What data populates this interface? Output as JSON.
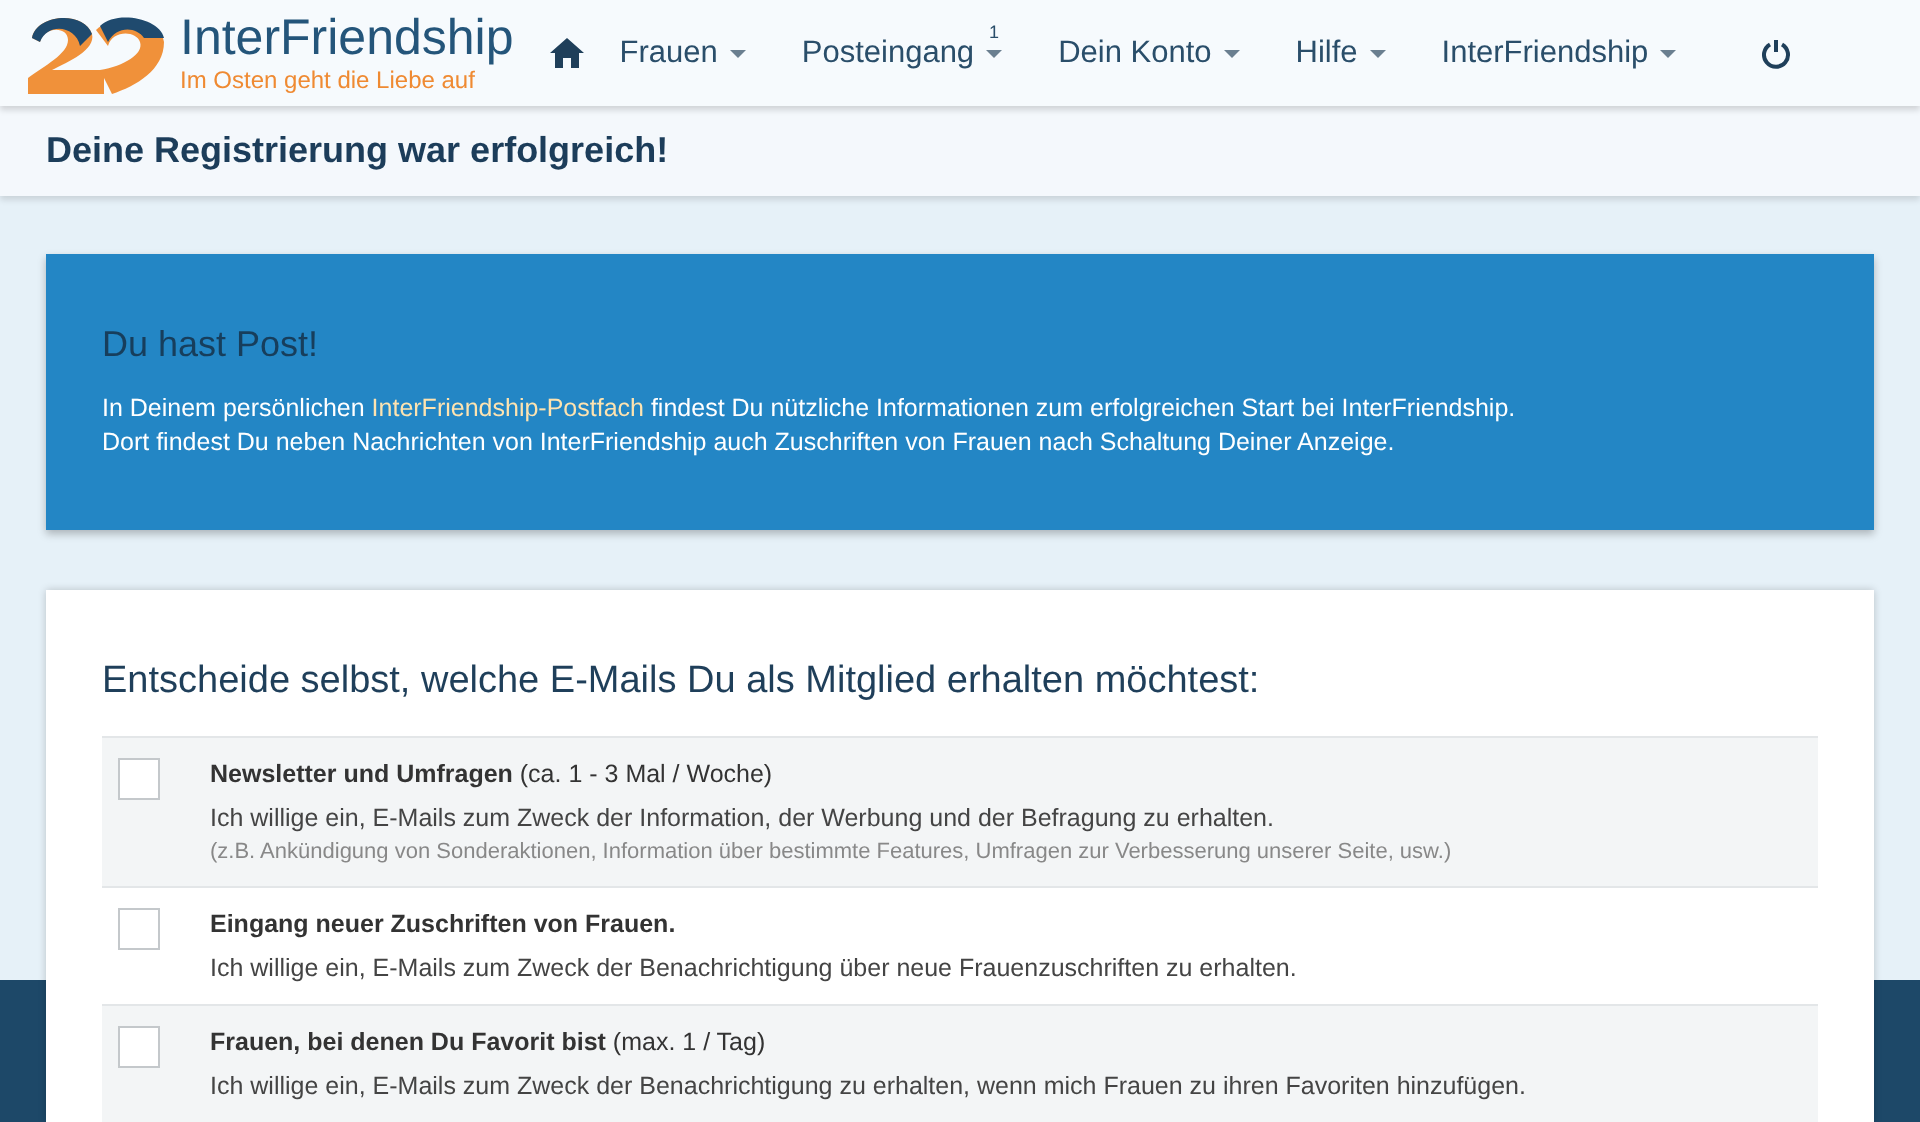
{
  "brand": {
    "name": "InterFriendship",
    "tagline": "Im Osten geht die Liebe auf"
  },
  "nav": [
    {
      "label": "Frauen"
    },
    {
      "label": "Posteingang",
      "badge": "1"
    },
    {
      "label": "Dein Konto"
    },
    {
      "label": "Hilfe"
    },
    {
      "label": "InterFriendship"
    }
  ],
  "page_title": "Deine Registrierung war erfolgreich!",
  "notice": {
    "title": "Du hast Post!",
    "before_link": "In Deinem persönlichen ",
    "link": "InterFriendship-Postfach",
    "after_link": " findest Du nützliche Informationen zum erfolgreichen Start bei InterFriendship.",
    "second_line": "Dort findest Du neben Nachrichten von InterFriendship auch Zuschriften von Frauen nach Schaltung Deiner Anzeige."
  },
  "email_settings": {
    "heading": "Entscheide selbst, welche E-Mails Du als Mitglied erhalten möchtest:",
    "options": [
      {
        "title": "**Newsletter und Umfragen** (ca. 1 - 3 Mal / Woche)",
        "description": "Ich willige ein, E-Mails zum Zweck der Information, der Werbung und der Befragung zu erhalten.",
        "note": "(z.B. Ankündigung von Sonderaktionen, Information über bestimmte Features, Umfragen zur Verbesserung unserer Seite, usw.)",
        "checked": false
      },
      {
        "title": "**Eingang neuer Zuschriften von Frauen.**",
        "description": "Ich willige ein, E-Mails zum Zweck der Benachrichtigung über neue Frauenzuschriften zu erhalten.",
        "checked": false
      },
      {
        "title": "**Frauen, bei denen Du Favorit bist** (max. 1 / Tag)",
        "description": "Ich willige ein, E-Mails zum Zweck der Benachrichtigung zu erhalten, wenn mich Frauen zu ihren Favoriten hinzufügen.",
        "checked": false
      }
    ]
  }
}
